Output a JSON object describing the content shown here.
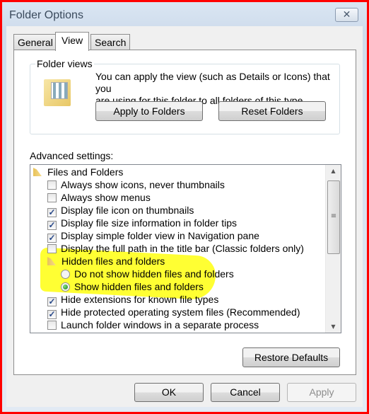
{
  "window": {
    "title": "Folder Options",
    "close_icon": "close-icon"
  },
  "tabs": [
    {
      "label": "General"
    },
    {
      "label": "View",
      "active": true
    },
    {
      "label": "Search"
    }
  ],
  "folder_views": {
    "label": "Folder views",
    "description_line1": "You can apply the view (such as Details or Icons) that you",
    "description_line2": "are using for this folder to all folders of this type.",
    "apply_label": "Apply to Folders",
    "reset_label": "Reset Folders"
  },
  "advanced": {
    "label": "Advanced settings:",
    "items": [
      {
        "type": "folder",
        "label": "Files and Folders"
      },
      {
        "type": "checkbox",
        "label": "Always show icons, never thumbnails",
        "checked": false
      },
      {
        "type": "checkbox",
        "label": "Always show menus",
        "checked": false
      },
      {
        "type": "checkbox",
        "label": "Display file icon on thumbnails",
        "checked": true
      },
      {
        "type": "checkbox",
        "label": "Display file size information in folder tips",
        "checked": true
      },
      {
        "type": "checkbox",
        "label": "Display simple folder view in Navigation pane",
        "checked": true
      },
      {
        "type": "checkbox",
        "label": "Display the full path in the title bar (Classic folders only)",
        "checked": false
      },
      {
        "type": "folder",
        "label": "Hidden files and folders"
      },
      {
        "type": "radio",
        "label": "Do not show hidden files and folders",
        "checked": false
      },
      {
        "type": "radio",
        "label": "Show hidden files and folders",
        "checked": true
      },
      {
        "type": "checkbox",
        "label": "Hide extensions for known file types",
        "checked": true
      },
      {
        "type": "checkbox",
        "label": "Hide protected operating system files (Recommended)",
        "checked": true
      },
      {
        "type": "checkbox",
        "label": "Launch folder windows in a separate process",
        "checked": false
      }
    ],
    "highlight_color": "#ffff33"
  },
  "buttons": {
    "restore": "Restore Defaults",
    "ok": "OK",
    "cancel": "Cancel",
    "apply": "Apply"
  }
}
